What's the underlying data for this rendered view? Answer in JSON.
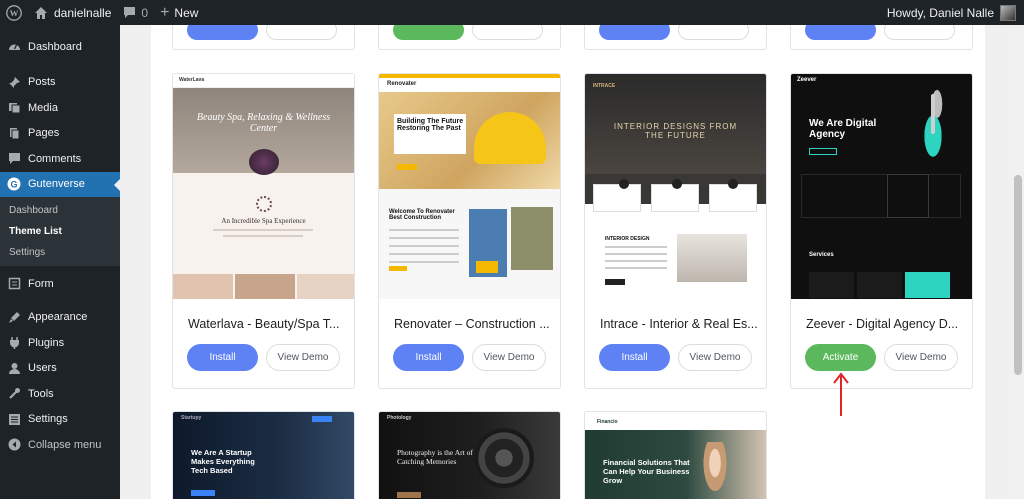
{
  "adminbar": {
    "site_name": "danielnalle",
    "comments_count": "0",
    "new_label": "New",
    "greeting": "Howdy, Daniel Nalle"
  },
  "sidebar": {
    "items": [
      {
        "label": "Dashboard",
        "icon": "dashboard-icon"
      },
      {
        "label": "Posts",
        "icon": "pin-icon"
      },
      {
        "label": "Media",
        "icon": "media-icon"
      },
      {
        "label": "Pages",
        "icon": "pages-icon"
      },
      {
        "label": "Comments",
        "icon": "comments-icon"
      },
      {
        "label": "Gutenverse",
        "icon": "gutenverse-icon"
      }
    ],
    "submenu": [
      "Dashboard",
      "Theme List",
      "Settings"
    ],
    "items2": [
      {
        "label": "Form",
        "icon": "form-icon"
      },
      {
        "label": "Appearance",
        "icon": "appearance-icon"
      },
      {
        "label": "Plugins",
        "icon": "plugins-icon"
      },
      {
        "label": "Users",
        "icon": "users-icon"
      },
      {
        "label": "Tools",
        "icon": "tools-icon"
      },
      {
        "label": "Settings",
        "icon": "settings-icon"
      },
      {
        "label": "Collapse menu",
        "icon": "collapse-icon"
      }
    ]
  },
  "themes": [
    {
      "title": "Waterlava - Beauty/Spa T...",
      "primary": "Install",
      "secondary": "View Demo",
      "thumb": {
        "brand": "WaterLava",
        "headline": "Beauty Spa, Relaxing & Wellness Center",
        "sub": "An Incredible Spa Experience"
      }
    },
    {
      "title": "Renovater – Construction ...",
      "primary": "Install",
      "secondary": "View Demo",
      "thumb": {
        "brand": "Renovater",
        "headline": "Building The Future Restoring The Past",
        "sub": "Welcome To Renovater Best Construction"
      }
    },
    {
      "title": "Intrace - Interior & Real Es...",
      "primary": "Install",
      "secondary": "View Demo",
      "thumb": {
        "brand": "INTRACE",
        "headline": "INTERIOR DESIGNS FROM THE FUTURE",
        "sub": "INTERIOR DESIGN"
      }
    },
    {
      "title": "Zeever - Digital Agency D...",
      "primary": "Activate",
      "secondary": "View Demo",
      "thumb": {
        "brand": "Zeever",
        "headline": "We Are Digital Agency",
        "sub": "Services"
      }
    }
  ],
  "bottom_themes": [
    {
      "headline": "We Are A Startup Makes Everything Tech Based",
      "brand": "Startupy"
    },
    {
      "headline": "Photography is the Art of Catching Memories",
      "brand": "Photology"
    },
    {
      "headline": "Financial Solutions That Can Help Your Business Grow",
      "brand": "Financio"
    }
  ],
  "colors": {
    "install": "#5e81f4",
    "activate": "#5cb85c",
    "arrow": "#e02424",
    "admin_bg": "#1d2327",
    "current": "#2271b1"
  }
}
